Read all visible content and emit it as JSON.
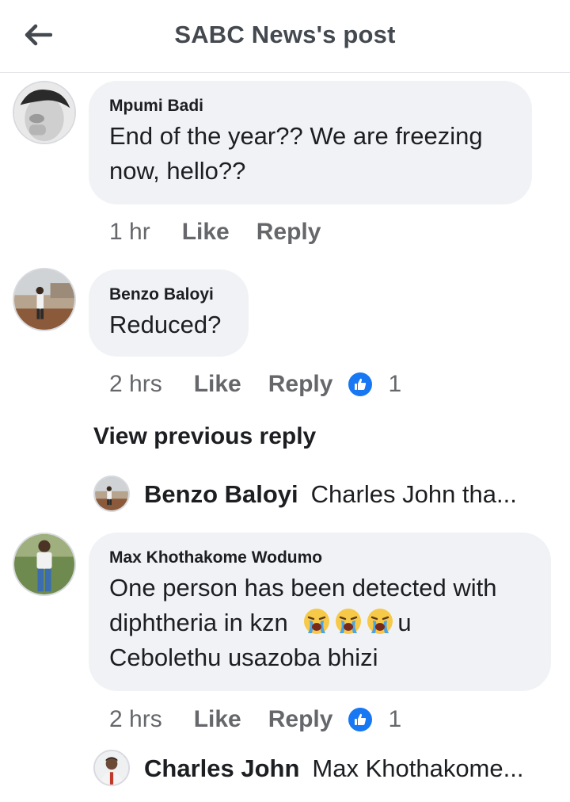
{
  "header": {
    "title": "SABC News's post"
  },
  "comments": [
    {
      "name": "Mpumi Badi",
      "text_lines": [
        "End of the year?? We  are freezing",
        "now, hello??"
      ],
      "time": "1 hr",
      "like_label": "Like",
      "reply_label": "Reply"
    },
    {
      "name": "Benzo Baloyi",
      "text_lines": [
        "Reduced?"
      ],
      "time": "2 hrs",
      "like_label": "Like",
      "reply_label": "Reply",
      "like_count": "1"
    },
    {
      "name": "Max Khothakome Wodumo",
      "text_lines": [
        "One person has been detected with",
        "diphtheria in kzn",
        "u",
        "Cebolethu usazoba bhizi"
      ],
      "time": "2 hrs",
      "like_label": "Like",
      "reply_label": "Reply",
      "like_count": "1"
    }
  ],
  "view_previous": "View previous reply",
  "replies": [
    {
      "name": "Benzo Baloyi",
      "text": "Charles John tha..."
    },
    {
      "name": "Charles John",
      "text": "Max Khothakome..."
    }
  ],
  "icons": {
    "back": "back-arrow-icon",
    "like": "thumbs-up-icon",
    "emoji": "loudly-crying-face-icon"
  },
  "colors": {
    "accent": "#1877f2",
    "bubble": "#f0f2f5",
    "meta": "#65676b"
  }
}
